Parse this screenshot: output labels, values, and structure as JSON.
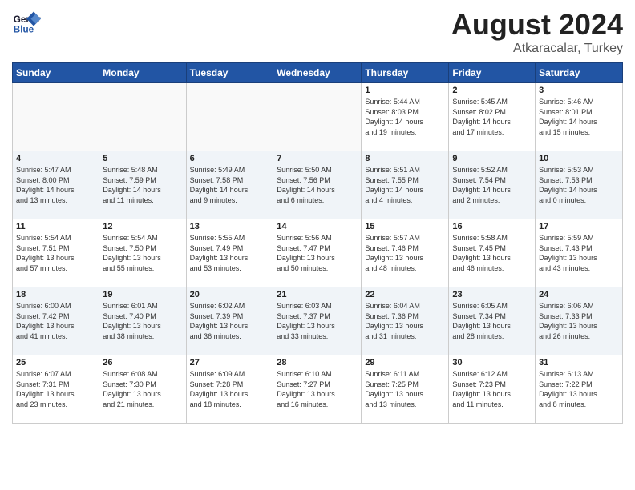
{
  "header": {
    "logo_line1": "General",
    "logo_line2": "Blue",
    "month_title": "August 2024",
    "subtitle": "Atkaracalar, Turkey"
  },
  "weekdays": [
    "Sunday",
    "Monday",
    "Tuesday",
    "Wednesday",
    "Thursday",
    "Friday",
    "Saturday"
  ],
  "weeks": [
    [
      {
        "day": "",
        "info": ""
      },
      {
        "day": "",
        "info": ""
      },
      {
        "day": "",
        "info": ""
      },
      {
        "day": "",
        "info": ""
      },
      {
        "day": "1",
        "info": "Sunrise: 5:44 AM\nSunset: 8:03 PM\nDaylight: 14 hours\nand 19 minutes."
      },
      {
        "day": "2",
        "info": "Sunrise: 5:45 AM\nSunset: 8:02 PM\nDaylight: 14 hours\nand 17 minutes."
      },
      {
        "day": "3",
        "info": "Sunrise: 5:46 AM\nSunset: 8:01 PM\nDaylight: 14 hours\nand 15 minutes."
      }
    ],
    [
      {
        "day": "4",
        "info": "Sunrise: 5:47 AM\nSunset: 8:00 PM\nDaylight: 14 hours\nand 13 minutes."
      },
      {
        "day": "5",
        "info": "Sunrise: 5:48 AM\nSunset: 7:59 PM\nDaylight: 14 hours\nand 11 minutes."
      },
      {
        "day": "6",
        "info": "Sunrise: 5:49 AM\nSunset: 7:58 PM\nDaylight: 14 hours\nand 9 minutes."
      },
      {
        "day": "7",
        "info": "Sunrise: 5:50 AM\nSunset: 7:56 PM\nDaylight: 14 hours\nand 6 minutes."
      },
      {
        "day": "8",
        "info": "Sunrise: 5:51 AM\nSunset: 7:55 PM\nDaylight: 14 hours\nand 4 minutes."
      },
      {
        "day": "9",
        "info": "Sunrise: 5:52 AM\nSunset: 7:54 PM\nDaylight: 14 hours\nand 2 minutes."
      },
      {
        "day": "10",
        "info": "Sunrise: 5:53 AM\nSunset: 7:53 PM\nDaylight: 14 hours\nand 0 minutes."
      }
    ],
    [
      {
        "day": "11",
        "info": "Sunrise: 5:54 AM\nSunset: 7:51 PM\nDaylight: 13 hours\nand 57 minutes."
      },
      {
        "day": "12",
        "info": "Sunrise: 5:54 AM\nSunset: 7:50 PM\nDaylight: 13 hours\nand 55 minutes."
      },
      {
        "day": "13",
        "info": "Sunrise: 5:55 AM\nSunset: 7:49 PM\nDaylight: 13 hours\nand 53 minutes."
      },
      {
        "day": "14",
        "info": "Sunrise: 5:56 AM\nSunset: 7:47 PM\nDaylight: 13 hours\nand 50 minutes."
      },
      {
        "day": "15",
        "info": "Sunrise: 5:57 AM\nSunset: 7:46 PM\nDaylight: 13 hours\nand 48 minutes."
      },
      {
        "day": "16",
        "info": "Sunrise: 5:58 AM\nSunset: 7:45 PM\nDaylight: 13 hours\nand 46 minutes."
      },
      {
        "day": "17",
        "info": "Sunrise: 5:59 AM\nSunset: 7:43 PM\nDaylight: 13 hours\nand 43 minutes."
      }
    ],
    [
      {
        "day": "18",
        "info": "Sunrise: 6:00 AM\nSunset: 7:42 PM\nDaylight: 13 hours\nand 41 minutes."
      },
      {
        "day": "19",
        "info": "Sunrise: 6:01 AM\nSunset: 7:40 PM\nDaylight: 13 hours\nand 38 minutes."
      },
      {
        "day": "20",
        "info": "Sunrise: 6:02 AM\nSunset: 7:39 PM\nDaylight: 13 hours\nand 36 minutes."
      },
      {
        "day": "21",
        "info": "Sunrise: 6:03 AM\nSunset: 7:37 PM\nDaylight: 13 hours\nand 33 minutes."
      },
      {
        "day": "22",
        "info": "Sunrise: 6:04 AM\nSunset: 7:36 PM\nDaylight: 13 hours\nand 31 minutes."
      },
      {
        "day": "23",
        "info": "Sunrise: 6:05 AM\nSunset: 7:34 PM\nDaylight: 13 hours\nand 28 minutes."
      },
      {
        "day": "24",
        "info": "Sunrise: 6:06 AM\nSunset: 7:33 PM\nDaylight: 13 hours\nand 26 minutes."
      }
    ],
    [
      {
        "day": "25",
        "info": "Sunrise: 6:07 AM\nSunset: 7:31 PM\nDaylight: 13 hours\nand 23 minutes."
      },
      {
        "day": "26",
        "info": "Sunrise: 6:08 AM\nSunset: 7:30 PM\nDaylight: 13 hours\nand 21 minutes."
      },
      {
        "day": "27",
        "info": "Sunrise: 6:09 AM\nSunset: 7:28 PM\nDaylight: 13 hours\nand 18 minutes."
      },
      {
        "day": "28",
        "info": "Sunrise: 6:10 AM\nSunset: 7:27 PM\nDaylight: 13 hours\nand 16 minutes."
      },
      {
        "day": "29",
        "info": "Sunrise: 6:11 AM\nSunset: 7:25 PM\nDaylight: 13 hours\nand 13 minutes."
      },
      {
        "day": "30",
        "info": "Sunrise: 6:12 AM\nSunset: 7:23 PM\nDaylight: 13 hours\nand 11 minutes."
      },
      {
        "day": "31",
        "info": "Sunrise: 6:13 AM\nSunset: 7:22 PM\nDaylight: 13 hours\nand 8 minutes."
      }
    ]
  ]
}
